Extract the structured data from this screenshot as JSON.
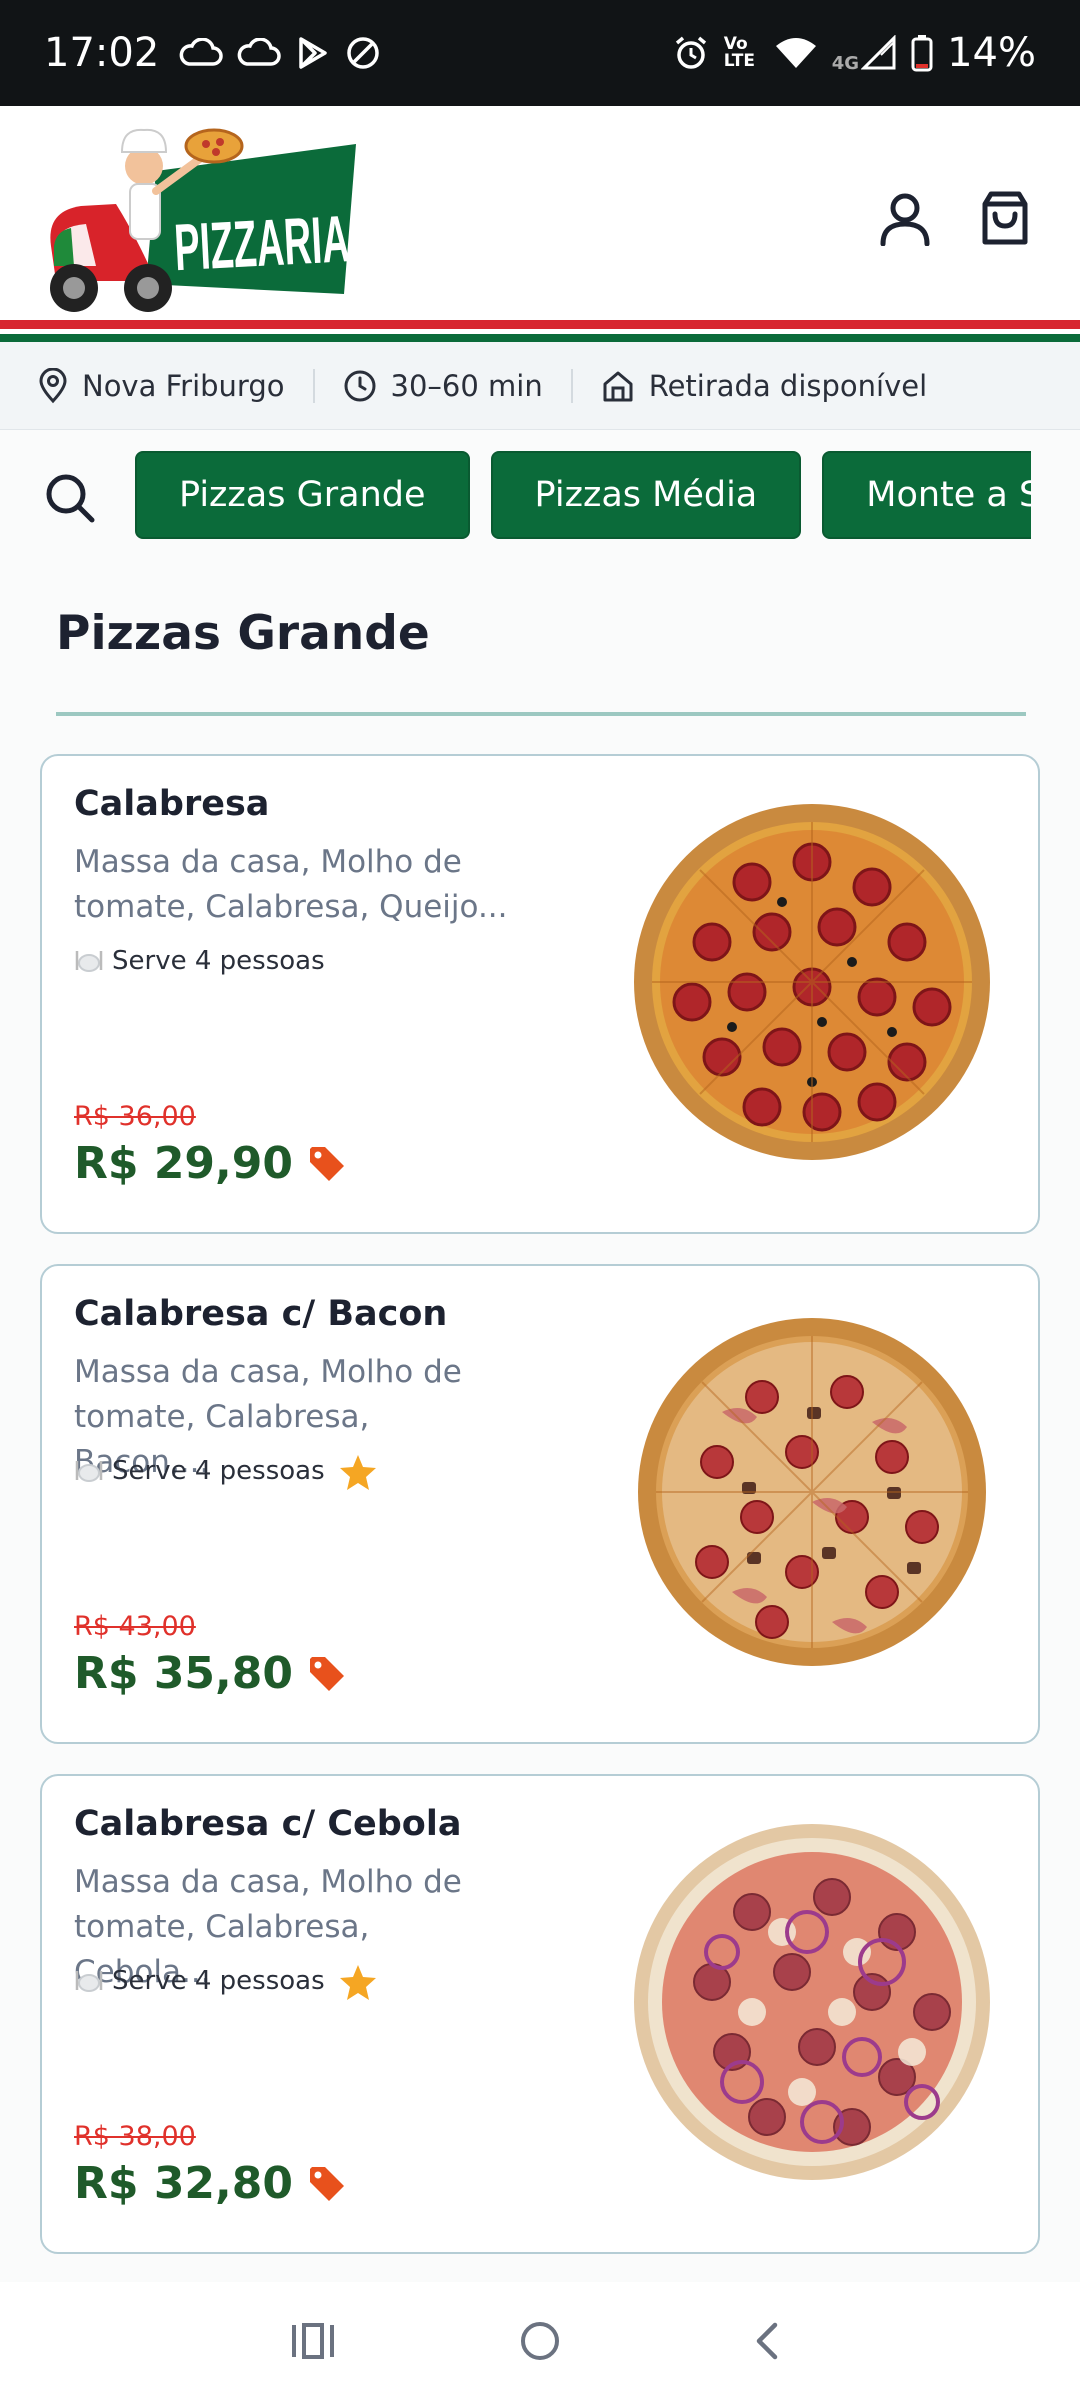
{
  "status": {
    "time": "17:02",
    "battery": "14%",
    "network": "4G",
    "volte": "Vo LTE"
  },
  "header": {
    "logo_text": "PIZZARIA"
  },
  "info": {
    "location": "Nova Friburgo",
    "time": "30–60 min",
    "pickup": "Retirada disponível"
  },
  "tabs": [
    {
      "label": "Pizzas Grande"
    },
    {
      "label": "Pizzas Média"
    },
    {
      "label": "Monte a Sua"
    }
  ],
  "section": {
    "title": "Pizzas Grande"
  },
  "products": [
    {
      "name": "Calabresa",
      "desc": "Massa da casa, Molho de tomate, Calabresa, Queijo...",
      "serves": "Serve 4 pessoas",
      "old_price": "R$ 36,00",
      "price": "R$ 29,90",
      "featured": false
    },
    {
      "name": "Calabresa c/ Bacon",
      "desc": "Massa da casa, Molho de tomate, Calabresa, Bacon,...",
      "serves": "Serve 4 pessoas",
      "old_price": "R$ 43,00",
      "price": "R$ 35,80",
      "featured": true
    },
    {
      "name": "Calabresa c/ Cebola",
      "desc": "Massa da casa, Molho de tomate, Calabresa, Cebola...",
      "serves": "Serve 4 pessoas",
      "old_price": "R$ 38,00",
      "price": "R$ 32,80",
      "featured": true
    }
  ],
  "colors": {
    "brand_green": "#0b6b3a",
    "price_green": "#1f5a2a",
    "old_price_red": "#e0312b",
    "stripe_red": "#d7262f",
    "tag_orange": "#e8511c",
    "star": "#f5a623"
  }
}
